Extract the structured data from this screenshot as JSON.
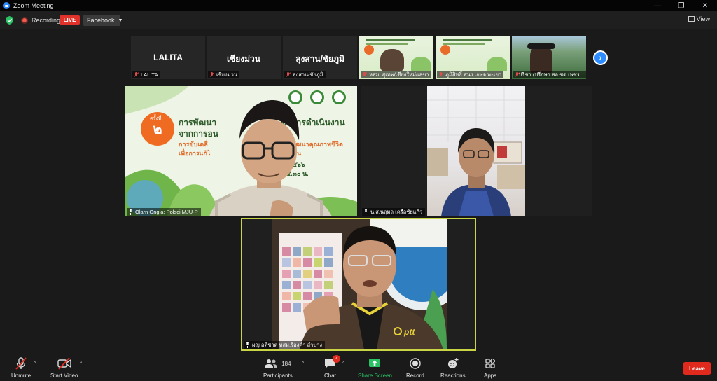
{
  "window": {
    "title": "Zoom Meeting",
    "controls": [
      "—",
      "❐",
      "✕"
    ]
  },
  "status": {
    "recording_label": "Recording",
    "live_badge": "LIVE",
    "stream_target": "Facebook",
    "view_label": "View"
  },
  "thumbnails": [
    {
      "big_name": "LALITA",
      "name": "LALITA"
    },
    {
      "big_name": "เชียงม่วน",
      "name": "เชียงม่วน"
    },
    {
      "big_name": "ลุงสาน/ชัยภูมิ",
      "name": "ลุงสาน/ชัยภูมิ"
    },
    {
      "big_name": "",
      "name": "หสม. สุเทพ/เชียงใหม่/เลขา"
    },
    {
      "big_name": "",
      "name": "ภูมิสิทธิ์ สนง.เกษจ.พะเยา"
    },
    {
      "big_name": "",
      "name": "ปรีชา (ปรีกษา สอ.ชด.เพชร..."
    }
  ],
  "tiles": {
    "a_name": "Olarn Ongla: Polsci MJU-P",
    "b_name": "น.ส.นฤมล  เครือชัยแก้ว",
    "c_name": "ผญ อติชาต หสม.ร้องคำ ลำปาง"
  },
  "slide": {
    "badge_top": "ครั้งที่",
    "badge_num": "๒",
    "line1": "การพัฒนา",
    "line1b": "ดับการดำเนินงาน",
    "line2": "จากการอน",
    "line3": "การขับเคลื่",
    "line3b": "การพัฒนาคุณภาพชีวิต",
    "line4": "เพื่อการแก้ไ",
    "line4b": "ยั่งยืน",
    "line5": "ม ๒๕๖๖",
    "line6": "๐๕.๓๐ น."
  },
  "shirt_logo": "ptt",
  "toolbar": {
    "unmute": "Unmute",
    "start_video": "Start Video",
    "participants": "Participants",
    "participants_count": "184",
    "chat": "Chat",
    "chat_badge": "4",
    "share_screen": "Share Screen",
    "record": "Record",
    "reactions": "Reactions",
    "apps": "Apps",
    "leave": "Leave"
  },
  "colors": {
    "accent_blue": "#2d8cff",
    "live_red": "#e0312b",
    "share_green": "#29c164",
    "active_speaker_border": "#c9d544"
  }
}
